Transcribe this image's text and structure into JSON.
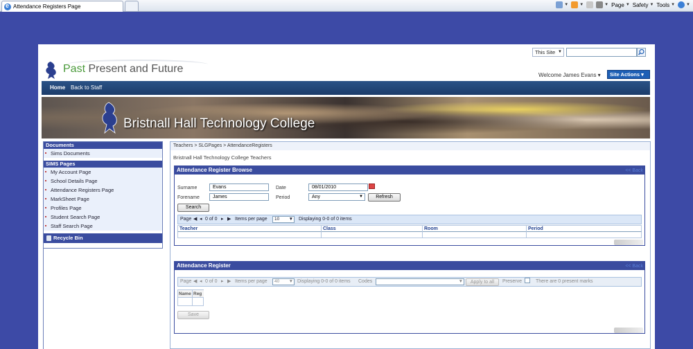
{
  "browser": {
    "tab_title": "Attendance Registers Page",
    "tools": [
      "Page",
      "Safety",
      "Tools"
    ]
  },
  "header": {
    "search_scope": "This Site",
    "site_name_part1": "Past",
    "site_name_part2": " Present and Future",
    "welcome": "Welcome James Evans",
    "site_actions": "Site Actions"
  },
  "topnav": {
    "home": "Home",
    "back": "Back to Staff"
  },
  "banner": {
    "title": "Bristnall Hall Technology College"
  },
  "leftnav": {
    "documents_header": "Documents",
    "documents": [
      "Sims Documents"
    ],
    "sims_header": "SIMS Pages",
    "sims_items": [
      "My Account Page",
      "School Details Page",
      "Attendance Registers Page",
      "MarkSheet Page",
      "Profiles Page",
      "Student Search Page",
      "Staff Search Page"
    ],
    "recycle": "Recycle Bin"
  },
  "main": {
    "breadcrumb": "Teachers > SLGPages > AttendanceRegisters",
    "page_title": "Bristnall Hall Technology College Teachers"
  },
  "browse": {
    "title": "Attendance Register Browse",
    "back": "<< Back",
    "surname_label": "Surname",
    "surname_value": "Evans",
    "forename_label": "Forename",
    "forename_value": "James",
    "date_label": "Date",
    "date_value": "08/01/2010",
    "period_label": "Period",
    "period_value": "Any",
    "refresh": "Refresh",
    "search": "Search",
    "pager": {
      "page": "Page",
      "of": "0 of 0",
      "items_per_page": "Items per page",
      "size": "10",
      "displaying": "Displaying 0-0 of 0 items"
    },
    "columns": [
      "Teacher",
      "Class",
      "Room",
      "Period"
    ]
  },
  "register": {
    "title": "Attendance Register",
    "back": "<< Back",
    "pager": {
      "page": "Page",
      "of": "0 of 0",
      "items_per_page": "Items per page",
      "size": "40",
      "displaying": "Displaying 0-0 of 0 items",
      "codes": "Codes",
      "apply": "Apply to all",
      "preserve": "Preserve",
      "present": "There are 0 present marks"
    },
    "columns": [
      "Name",
      "Reg"
    ],
    "save": "Save"
  }
}
